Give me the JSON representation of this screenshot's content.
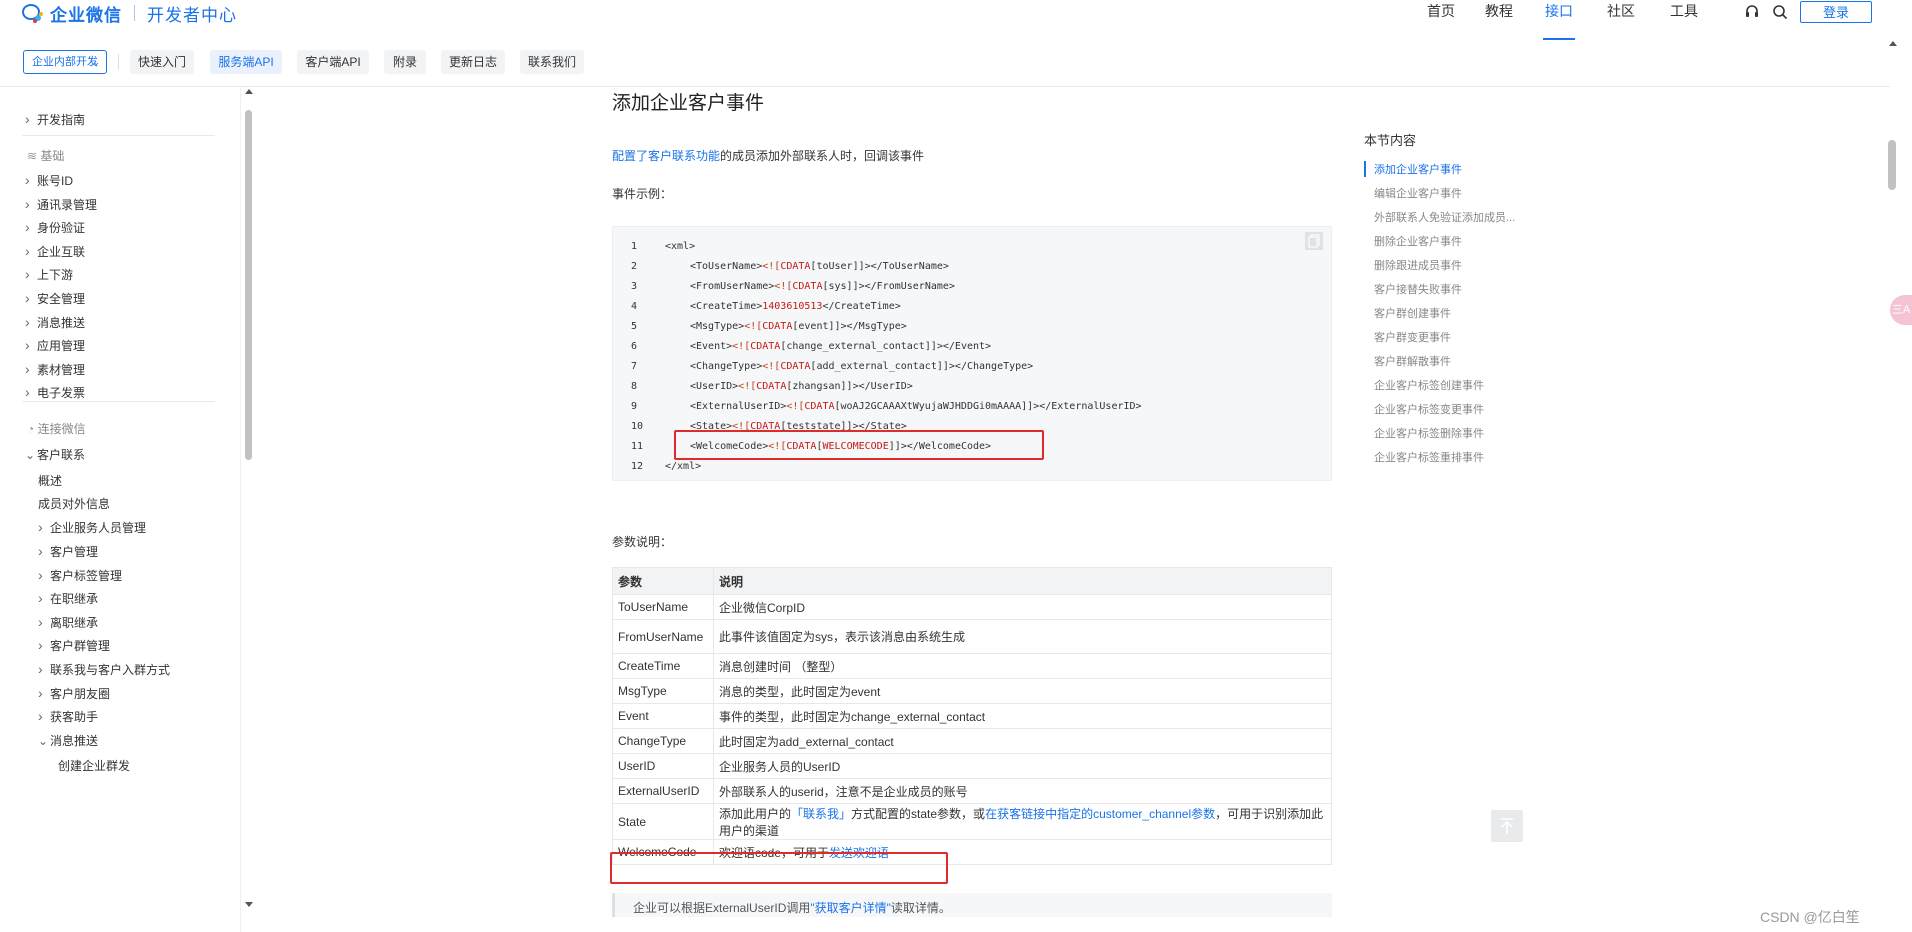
{
  "header": {
    "brand": "企业微信",
    "sub_brand": "开发者中心",
    "nav": [
      {
        "label": "首页"
      },
      {
        "label": "教程"
      },
      {
        "label": "接口"
      },
      {
        "label": "社区"
      },
      {
        "label": "工具"
      }
    ],
    "active_nav": "接口",
    "login_label": "登录",
    "accent_color": "#1a73e8"
  },
  "subnav": {
    "dropdown_label": "企业内部开发",
    "tabs": [
      {
        "label": "快速入门"
      },
      {
        "label": "服务端API"
      },
      {
        "label": "客户端API"
      },
      {
        "label": "附录"
      },
      {
        "label": "更新日志"
      },
      {
        "label": "联系我们"
      }
    ],
    "active_tab": "服务端API"
  },
  "sidebar": {
    "items": [
      {
        "label": "开发指南",
        "kind": "item",
        "chevron": "right"
      },
      {
        "label": "基础",
        "kind": "category",
        "icon": "layers-icon"
      },
      {
        "label": "账号ID",
        "kind": "item",
        "chevron": "right"
      },
      {
        "label": "通讯录管理",
        "kind": "item",
        "chevron": "right"
      },
      {
        "label": "身份验证",
        "kind": "item",
        "chevron": "right"
      },
      {
        "label": "企业互联",
        "kind": "item",
        "chevron": "right"
      },
      {
        "label": "上下游",
        "kind": "item",
        "chevron": "right"
      },
      {
        "label": "安全管理",
        "kind": "item",
        "chevron": "right"
      },
      {
        "label": "消息推送",
        "kind": "item",
        "chevron": "right"
      },
      {
        "label": "应用管理",
        "kind": "item",
        "chevron": "right"
      },
      {
        "label": "素材管理",
        "kind": "item",
        "chevron": "right"
      },
      {
        "label": "电子发票",
        "kind": "item",
        "chevron": "right"
      },
      {
        "label": "连接微信",
        "kind": "category",
        "icon": "wechat-icon"
      },
      {
        "label": "客户联系",
        "kind": "item",
        "chevron": "down"
      },
      {
        "label": "概述",
        "kind": "leaf"
      },
      {
        "label": "成员对外信息",
        "kind": "leaf"
      },
      {
        "label": "企业服务人员管理",
        "kind": "sub",
        "chevron": "right"
      },
      {
        "label": "客户管理",
        "kind": "sub",
        "chevron": "right"
      },
      {
        "label": "客户标签管理",
        "kind": "sub",
        "chevron": "right"
      },
      {
        "label": "在职继承",
        "kind": "sub",
        "chevron": "right"
      },
      {
        "label": "离职继承",
        "kind": "sub",
        "chevron": "right"
      },
      {
        "label": "客户群管理",
        "kind": "sub",
        "chevron": "right"
      },
      {
        "label": "联系我与客户入群方式",
        "kind": "sub",
        "chevron": "right"
      },
      {
        "label": "客户朋友圈",
        "kind": "sub",
        "chevron": "right"
      },
      {
        "label": "获客助手",
        "kind": "sub",
        "chevron": "right"
      },
      {
        "label": "消息推送",
        "kind": "sub",
        "chevron": "down"
      },
      {
        "label": "创建企业群发",
        "kind": "subleaf"
      }
    ]
  },
  "content": {
    "title": "添加企业客户事件",
    "intro_link": "配置了客户联系功能",
    "intro_text": "的成员添加外部联系人时，回调该事件",
    "example_label": "事件示例：",
    "code_lines": [
      {
        "n": "1",
        "indent": 0,
        "parts": [
          {
            "t": "<xml>",
            "c": "tag"
          }
        ]
      },
      {
        "n": "2",
        "indent": 1,
        "parts": [
          {
            "t": "<ToUserName>",
            "c": "tag"
          },
          {
            "t": "<![",
            "c": "cd"
          },
          {
            "t": "CDATA",
            "c": "kw"
          },
          {
            "t": "[toUser]]>",
            "c": "tag"
          },
          {
            "t": "</ToUserName>",
            "c": "tag"
          }
        ]
      },
      {
        "n": "3",
        "indent": 1,
        "parts": [
          {
            "t": "<FromUserName>",
            "c": "tag"
          },
          {
            "t": "<![",
            "c": "cd"
          },
          {
            "t": "CDATA",
            "c": "kw"
          },
          {
            "t": "[sys]]>",
            "c": "tag"
          },
          {
            "t": "</FromUserName>",
            "c": "tag"
          }
        ]
      },
      {
        "n": "4",
        "indent": 1,
        "parts": [
          {
            "t": "<CreateTime>",
            "c": "tag"
          },
          {
            "t": "1403610513",
            "c": "kw"
          },
          {
            "t": "</CreateTime>",
            "c": "tag"
          }
        ]
      },
      {
        "n": "5",
        "indent": 1,
        "parts": [
          {
            "t": "<MsgType>",
            "c": "tag"
          },
          {
            "t": "<![",
            "c": "cd"
          },
          {
            "t": "CDATA",
            "c": "kw"
          },
          {
            "t": "[event]]>",
            "c": "tag"
          },
          {
            "t": "</MsgType>",
            "c": "tag"
          }
        ]
      },
      {
        "n": "6",
        "indent": 1,
        "parts": [
          {
            "t": "<Event>",
            "c": "tag"
          },
          {
            "t": "<![",
            "c": "cd"
          },
          {
            "t": "CDATA",
            "c": "kw"
          },
          {
            "t": "[change_external_contact]]>",
            "c": "tag"
          },
          {
            "t": "</Event>",
            "c": "tag"
          }
        ]
      },
      {
        "n": "7",
        "indent": 1,
        "parts": [
          {
            "t": "<ChangeType>",
            "c": "tag"
          },
          {
            "t": "<![",
            "c": "cd"
          },
          {
            "t": "CDATA",
            "c": "kw"
          },
          {
            "t": "[add_external_contact]]>",
            "c": "tag"
          },
          {
            "t": "</ChangeType>",
            "c": "tag"
          }
        ]
      },
      {
        "n": "8",
        "indent": 1,
        "parts": [
          {
            "t": "<UserID>",
            "c": "tag"
          },
          {
            "t": "<![",
            "c": "cd"
          },
          {
            "t": "CDATA",
            "c": "kw"
          },
          {
            "t": "[zhangsan]]>",
            "c": "tag"
          },
          {
            "t": "</UserID>",
            "c": "tag"
          }
        ]
      },
      {
        "n": "9",
        "indent": 1,
        "parts": [
          {
            "t": "<ExternalUserID>",
            "c": "tag"
          },
          {
            "t": "<![",
            "c": "cd"
          },
          {
            "t": "CDATA",
            "c": "kw"
          },
          {
            "t": "[woAJ2GCAAAXtWyujaWJHDDGi0mAAAA]]>",
            "c": "tag"
          },
          {
            "t": "</ExternalUserID>",
            "c": "tag"
          }
        ]
      },
      {
        "n": "10",
        "indent": 1,
        "parts": [
          {
            "t": "<State>",
            "c": "tag"
          },
          {
            "t": "<![",
            "c": "cd"
          },
          {
            "t": "CDATA",
            "c": "kw"
          },
          {
            "t": "[teststate]]>",
            "c": "tag"
          },
          {
            "t": "</State>",
            "c": "tag"
          }
        ]
      },
      {
        "n": "11",
        "indent": 1,
        "parts": [
          {
            "t": "<WelcomeCode>",
            "c": "tag"
          },
          {
            "t": "<![",
            "c": "cd"
          },
          {
            "t": "CDATA",
            "c": "kw"
          },
          {
            "t": "[",
            "c": "tag"
          },
          {
            "t": "WELCOMECODE",
            "c": "kw"
          },
          {
            "t": "]]>",
            "c": "tag"
          },
          {
            "t": "</WelcomeCode>",
            "c": "tag"
          }
        ]
      },
      {
        "n": "12",
        "indent": 0,
        "parts": [
          {
            "t": "</xml>",
            "c": "tag"
          }
        ]
      }
    ],
    "params_label": "参数说明：",
    "table_headers": [
      "参数",
      "说明"
    ],
    "table_rows": [
      {
        "name": "ToUserName",
        "desc": "企业微信CorpID"
      },
      {
        "name": "FromUserName",
        "desc": "此事件该值固定为sys，表示该消息由系统生成"
      },
      {
        "name": "CreateTime",
        "desc": "消息创建时间 （整型）"
      },
      {
        "name": "MsgType",
        "desc": "消息的类型，此时固定为event"
      },
      {
        "name": "Event",
        "desc": "事件的类型，此时固定为change_external_contact"
      },
      {
        "name": "ChangeType",
        "desc": "此时固定为add_external_contact"
      },
      {
        "name": "UserID",
        "desc": "企业服务人员的UserID"
      },
      {
        "name": "ExternalUserID",
        "desc": "外部联系人的userid，注意不是企业成员的账号"
      },
      {
        "name": "State",
        "desc_parts": [
          {
            "t": "添加此用户的"
          },
          {
            "t": "「联系我」",
            "link": true
          },
          {
            "t": "方式配置的state参数，或"
          },
          {
            "t": "在获客链接中指定的customer_channel参数",
            "link": true
          },
          {
            "t": "，可用于识别添加此用户的渠道"
          }
        ]
      },
      {
        "name": "WelcomeCode",
        "desc_parts": [
          {
            "t": "欢迎语code，可用于"
          },
          {
            "t": "发送欢迎语",
            "link": true
          }
        ]
      }
    ],
    "note_parts": [
      {
        "t": "企业可以根据ExternalUserID调用"
      },
      {
        "t": "\"获取客户详情\"",
        "link": true
      },
      {
        "t": "读取详情。"
      }
    ]
  },
  "toc": {
    "title": "本节内容",
    "items": [
      "添加企业客户事件",
      "编辑企业客户事件",
      "外部联系人免验证添加成员...",
      "删除企业客户事件",
      "删除跟进成员事件",
      "客户接替失败事件",
      "客户群创建事件",
      "客户群变更事件",
      "客户群解散事件",
      "企业客户标签创建事件",
      "企业客户标签变更事件",
      "企业客户标签删除事件",
      "企业客户标签重排事件"
    ],
    "active_index": 0
  },
  "side_float_label": "三A",
  "watermark": "CSDN @亿白笙",
  "highlight_color": "#e02b2b"
}
